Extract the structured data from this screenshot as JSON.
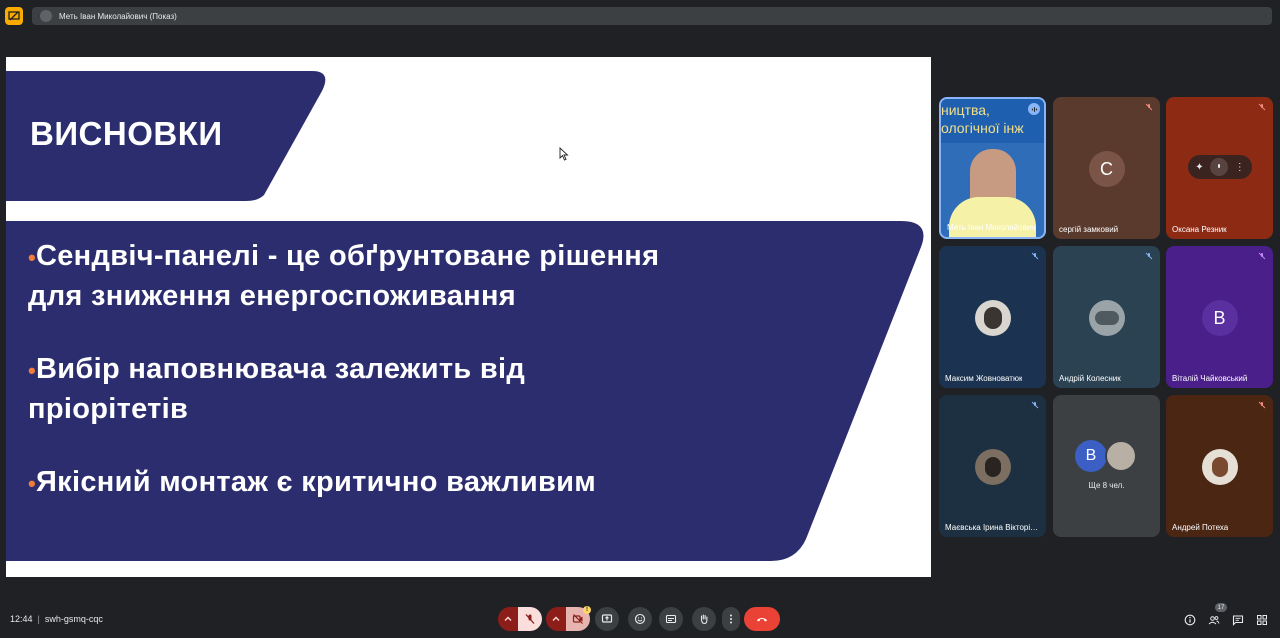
{
  "top_bar": {
    "presenter_title": "Меть Іван Миколайович (Показ)"
  },
  "slide": {
    "title": "ВИСНОВКИ",
    "bullets": [
      "Сендвіч-панелі - це обґрунтоване рішення для зниження енергоспоживання",
      "Вибір наповнювача залежить від пріорітетів",
      "Якісний монтаж є критично важливим"
    ],
    "bullet_lines": [
      [
        "Сендвіч-панелі - це обґрунтоване рішення",
        "для зниження енергоспоживання"
      ],
      [
        "Вибір наповнювача залежить від",
        "пріорітетів"
      ],
      [
        "Якісний монтаж є критично важливим"
      ]
    ],
    "colors": {
      "panel": "#2b2d6e",
      "bullet_dot": "#ef7d39",
      "background": "#ffffff"
    }
  },
  "participants": [
    {
      "name": "Меть Іван Миколайович",
      "banner_text": [
        "ництва,",
        "ологічної інж"
      ],
      "state": "speaking",
      "bg": "#2f6db8"
    },
    {
      "name": "сергій замковий",
      "initial": "С",
      "muted": true,
      "bg": "#5b3a2e",
      "ava_bg": "#7a5547"
    },
    {
      "name": "Оксана Резник",
      "muted": true,
      "bg": "#8d2a14",
      "hover": true
    },
    {
      "name": "Максим Жовноватюк",
      "muted": true,
      "bg": "#1b3350"
    },
    {
      "name": "Андрій Колесник",
      "muted": true,
      "bg": "#2b4252"
    },
    {
      "name": "Віталій Чайковський",
      "initial": "В",
      "muted": true,
      "bg": "#4a1f8a",
      "ava_bg": "#5a2fa0"
    },
    {
      "name": "Маєвська Ірина Вікторівна",
      "muted": true,
      "bg": "#1c3042"
    },
    {
      "name": "Ще 8 чел.",
      "initial": "В",
      "bg": "#3c4043",
      "ava_bg": "#3b5fc4"
    },
    {
      "name": "Андрей Потеха",
      "muted": true,
      "bg": "#4a2613"
    }
  ],
  "bottom_bar": {
    "time": "12:44",
    "meeting_code": "swh-gsmq-cqc",
    "people_count": "17",
    "camera_warning": "!"
  }
}
